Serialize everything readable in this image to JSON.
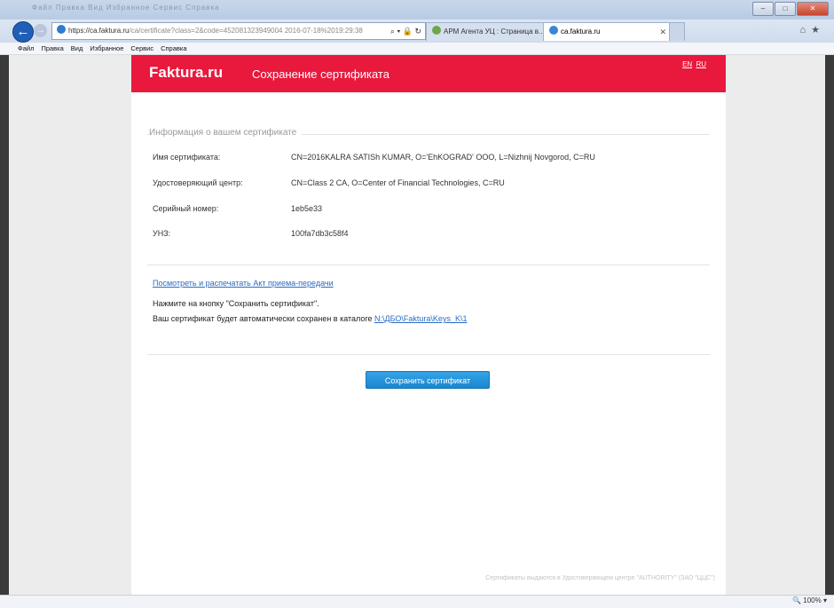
{
  "browser": {
    "title_blurred": "Файл Правка Вид Избранное Сервис Справка",
    "address": {
      "host": "https://ca.faktura.ru",
      "path": "/ca/certificate?class=2&code=452081323949004 2016-07-18%2019:29:38"
    },
    "tabs": [
      {
        "label": "АРМ Агента УЦ : Страница в..."
      },
      {
        "label": "ca.faktura.ru"
      }
    ],
    "menu": [
      "Файл",
      "Правка",
      "Вид",
      "Избранное",
      "Сервис",
      "Справка"
    ],
    "zoom": "100%"
  },
  "header": {
    "logo": "Faktura.ru",
    "title": "Сохранение сертификата",
    "lang_en": "EN",
    "lang_ru": "RU"
  },
  "info": {
    "section_title": "Информация о вашем сертификате",
    "rows": [
      {
        "label": "Имя сертификата:",
        "value": "CN=2016KALRA SATISh KUMAR, O='EhKOGRAD' OOO, L=Nizhnij Novgorod, C=RU"
      },
      {
        "label": "Удостоверяющий центр:",
        "value": "CN=Class 2 CA, O=Center of Financial Technologies, C=RU"
      },
      {
        "label": "Серийный номер:",
        "value": "1eb5e33"
      },
      {
        "label": "УНЗ:",
        "value": "100fa7db3c58f4"
      }
    ]
  },
  "act_link": "Посмотреть и распечатать Акт приема-передачи",
  "instruction_1": "Нажмите на кнопку \"Сохранить сертификат\".",
  "instruction_2": "Ваш сертификат будет автоматически сохранен в каталоге ",
  "save_path": "N:\\ДБО\\Faktura\\Keys_K\\1",
  "save_button": "Сохранить сертификат",
  "footer": "Сертификаты выдаются в Удостоверяющем центре \"AUTHORITY\" (ЗАО \"ЦЦС\")"
}
